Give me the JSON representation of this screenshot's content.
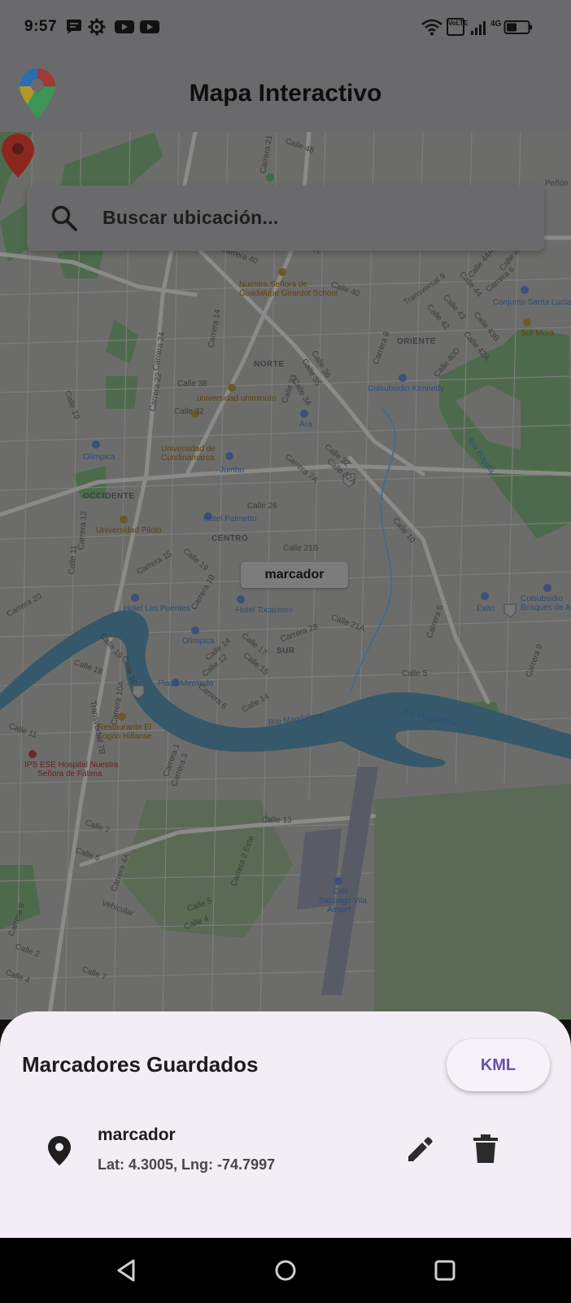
{
  "status_bar": {
    "time": "9:57",
    "left_icons": [
      "chat-bubble-icon",
      "settings-gear-icon",
      "youtube-icon",
      "youtube-icon"
    ],
    "right_icons": [
      "wifi-icon",
      "volte-icon",
      "signal-icon",
      "battery-icon"
    ],
    "network_label": "4G",
    "volte_label": "VoLTE"
  },
  "app_bar": {
    "logo_icon": "google-maps-pin-icon",
    "title": "Mapa Interactivo"
  },
  "search": {
    "icon": "search-icon",
    "placeholder": "Buscar ubicación..."
  },
  "map": {
    "districts": [
      "NORTE",
      "ORIENTE",
      "OCCIDENTE",
      "CENTRO",
      "SUR"
    ],
    "places": {
      "nuestra_senora_1": "Nuestra Señora de",
      "nuestra_senora_2": "Guadalupe Girardot School",
      "uniminuto": "universidad uniminuto",
      "cundinamarca_1": "Universidad de",
      "cundinamarca_2": "Cundinamarca",
      "olimpica_1": "Olímpica",
      "olimpica_2": "Olímpica",
      "jumbo": "Jumbo",
      "ara": "Ara",
      "colsubsidio_kennedy": "Colsubsidio Kennedy",
      "conjunto": "Conjunto Santa Lucía",
      "sur_mora": "Sur Mora",
      "hotel_palmetto": "Hotel Palmetto",
      "universidad_piloto": "Universidad Piloto",
      "hotel_puentes": "Hotel Las Puentes",
      "hotel_tocaremo": "Hotel Tocaremo",
      "plaza_mirolindo": "Plaza Mirolindo",
      "exito": "Éxito",
      "colsubsidio_bosques_1": "Colsubsidio",
      "colsubsidio_bosques_2": "Bosques de Athe",
      "restaurante_1": "Restaurante El",
      "restaurante_2": "Fogón Hillanse",
      "ips_1": "IPS ESE Hospital Nuestra",
      "ips_2": "Señora de Fátima",
      "airport_1": "GIR",
      "airport_2": "Santiago Vila",
      "airport_3": "Airport",
      "rio_1": "Río Magdalena",
      "rio_2": "Río Magdalena",
      "rio_bogota": "Río Bogotá",
      "penon": "Peñón",
      "calle_40b": "Calle 40",
      "carrera_8": "Carrera 8"
    },
    "streets": {
      "calle_48": "Calle 48",
      "carrera_21": "Carrera 21",
      "calle_47": "Calle 47",
      "carrera_42a": "Carrera 42A",
      "carrera_40": "Carrera 40",
      "calle_40": "Calle 40",
      "carrera_24": "Carrera 24",
      "carrera_14": "Carrera 14",
      "carrera_22": "Carrera 22",
      "calle_38": "Calle 38",
      "calle_36": "Calle 36",
      "calle_35": "Calle 35",
      "calle_34": "Calle 34",
      "calle_33": "Calle 33",
      "calle_32": "Calle 32",
      "calle_19": "Calle 19",
      "calle_26": "Calle 26",
      "carrera_7a": "Carrera 7A",
      "calle_21b": "Calle 21B",
      "calle_10": "Calle 10",
      "carrera_15": "Carrera 15",
      "calle_19b": "Calle 19",
      "carrera_10": "Carrera 10",
      "carrera_20": "Carrera 20",
      "carrera_12": "Carrera 12",
      "calle_11": "Calle 11",
      "calle_17": "Calle 17",
      "calle_15": "Calle 15",
      "carrera_28": "Carrera 28",
      "calle_21a": "Calle 21A",
      "calle_14": "Calle 14",
      "calle_5": "Calle 5",
      "carrera_5": "Carrera 5",
      "carrera_9": "Carrera 9",
      "calle_19c": "Calle 19",
      "calle_18": "Calle 18",
      "calle_16": "Calle 16",
      "carrera_10a": "Carrera 10A",
      "transversal_7b": "Transversal 7B",
      "calle_11b": "Calle 11",
      "calle_13": "Calle 13",
      "calle_7": "Calle 7",
      "calle_6": "Calle 6",
      "carrera_4a": "Carrera 4A",
      "carrera_2": "Carrera 2 Este",
      "calle_5b": "Calle 5",
      "calle_4": "Calle 4",
      "calle_2": "Calle 2",
      "calle_4b": "Calle 4",
      "carrera_9b": "Carrera 9",
      "vehicular": "Vehicular",
      "transversal_9": "Transversal 9",
      "calle_44": "Calle 44",
      "calle_43": "Calle 43",
      "calle_42": "Calle 42",
      "calle_40d": "Calle 40D",
      "carrera_6": "Carrera 6",
      "calle_43b": "Calle 43B",
      "calle_42a": "Calle 42A",
      "calle_44a": "Calle 44A",
      "calle_45": "Calle 45",
      "calle_32a": "Calle 32A",
      "calle_32b": "Calle 32",
      "carrera_11": "Carrera 11",
      "calle_12": "Calle 12",
      "calle_14b": "Calle 14",
      "carrera_3": "Carrera 3",
      "carrera_4": "Carrera 4",
      "carrera_1": "Carrera 1",
      "carrera_8b": "Carrera 8",
      "carrera_6b": "Carrera 6",
      "calle_8": "Calle 8",
      "calle_5c": "Calle 5"
    },
    "route_badges": [
      "45",
      "45",
      "45",
      "45"
    ],
    "marker": {
      "label": "marcador",
      "icon": "map-pin-icon",
      "color": "#b3261e"
    }
  },
  "bottom_sheet": {
    "title": "Marcadores Guardados",
    "kml_button": "KML",
    "accent_color": "#6750a4",
    "items": [
      {
        "name": "marcador",
        "coords": "Lat: 4.3005, Lng: -74.7997",
        "icon": "location-pin-icon",
        "actions": [
          "edit-icon",
          "delete-icon"
        ]
      }
    ]
  },
  "nav_bar": {
    "buttons": [
      "back-icon",
      "home-icon",
      "recents-icon"
    ]
  }
}
